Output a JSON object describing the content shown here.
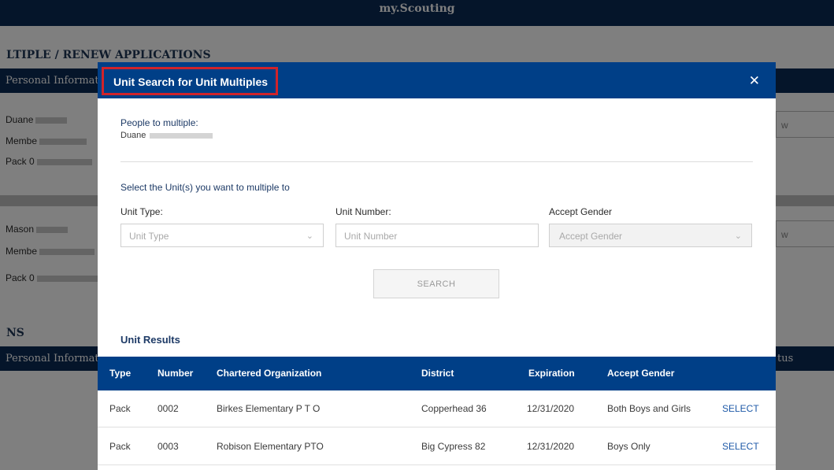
{
  "background": {
    "brand": "my.Scouting",
    "section_title": "LTIPLE / RENEW APPLICATIONS",
    "bar_label": "Personal Informatio",
    "persons": [
      {
        "name": "Duane",
        "member": "Membe",
        "unit": "Pack 0"
      },
      {
        "name": "Mason",
        "member": "Membe",
        "unit": "Pack 0"
      }
    ],
    "input_stub": "w",
    "section2_title": "NS",
    "bar2_label": "Personal Informatio",
    "status_label": "tus"
  },
  "modal": {
    "title": "Unit Search for Unit Multiples",
    "close_icon": "close-icon",
    "people_label": "People to multiple:",
    "people_name": "Duane",
    "select_instruction": "Select the Unit(s) you want to multiple to",
    "unit_type": {
      "label": "Unit Type:",
      "placeholder": "Unit Type"
    },
    "unit_number": {
      "label": "Unit Number:",
      "placeholder": "Unit Number"
    },
    "accept_gender": {
      "label": "Accept Gender",
      "placeholder": "Accept Gender"
    },
    "search_button": "SEARCH",
    "results_title": "Unit Results",
    "columns": [
      "Type",
      "Number",
      "Chartered Organization",
      "District",
      "Expiration",
      "Accept Gender"
    ],
    "rows": [
      {
        "type": "Pack",
        "number": "0002",
        "org": "Birkes Elementary P T O",
        "district": "Copperhead 36",
        "expiration": "12/31/2020",
        "gender": "Both Boys and Girls",
        "action": "SELECT"
      },
      {
        "type": "Pack",
        "number": "0003",
        "org": "Robison Elementary PTO",
        "district": "Big Cypress 82",
        "expiration": "12/31/2020",
        "gender": "Boys Only",
        "action": "SELECT"
      }
    ]
  },
  "colors": {
    "header_navy": "#0b2a55",
    "modal_blue": "#003f87",
    "highlight_red": "#d0232a",
    "link_blue": "#1f5aa8"
  }
}
